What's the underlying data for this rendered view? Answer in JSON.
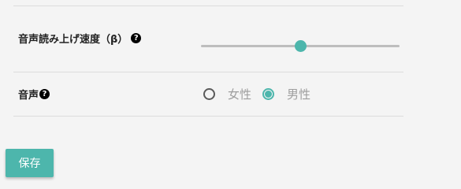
{
  "settings": {
    "speech_rate": {
      "label": "音声読み上げ速度（β）",
      "help_icon": "question-circle-icon",
      "help_glyph": "?",
      "value_fraction": 0.5
    },
    "voice": {
      "label": "音声",
      "help_icon": "question-circle-icon",
      "help_glyph": "?",
      "options": [
        {
          "label": "女性",
          "checked": false
        },
        {
          "label": "男性",
          "checked": true
        }
      ]
    }
  },
  "actions": {
    "save_label": "保存"
  },
  "colors": {
    "accent": "#4db6ac",
    "background": "#f4f4f4",
    "divider": "#dcdcdc"
  }
}
